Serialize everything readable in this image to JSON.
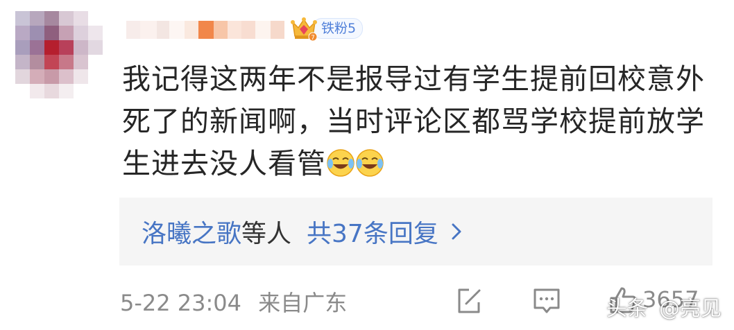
{
  "comment": {
    "fan_badge": "铁粉5",
    "text": "我记得这两年不是报导过有学生提前回校意外死了的新闻啊，当时评论区都骂学校提前放学生进去没人看管",
    "emoji_icons": [
      "laughing-crying-emoji",
      "laughing-crying-emoji"
    ]
  },
  "replies": {
    "name": "洛曦之歌",
    "etc": "等人",
    "total": "共37条回复"
  },
  "meta": {
    "time": "5-22 23:04",
    "location": "来自广东",
    "like_count": "3657"
  },
  "watermark": {
    "platform": "头条",
    "author": "@亮见"
  },
  "colors": {
    "link": "#4775c4",
    "muted": "#8a8a8a",
    "badge_text": "#4f7fd9",
    "reply_bg": "#f5f5f5"
  }
}
